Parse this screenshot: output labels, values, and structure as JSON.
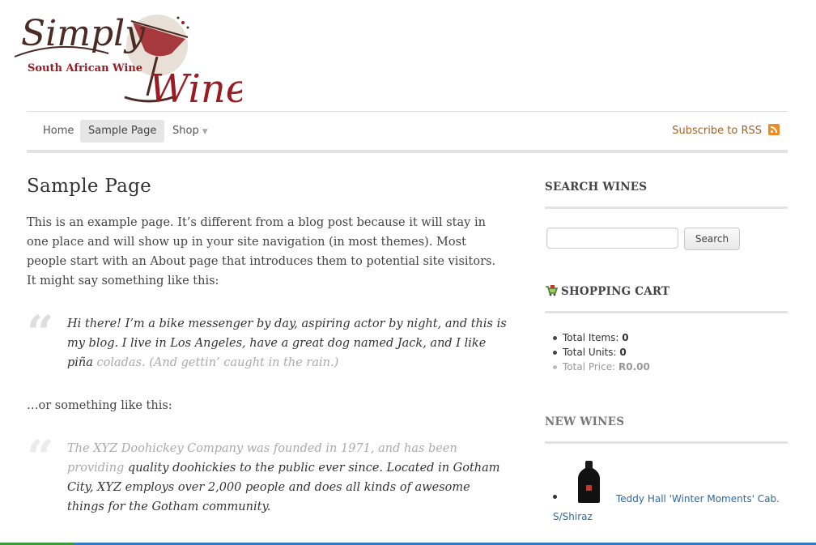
{
  "logo": {
    "word1": "Simply",
    "word2": "Wine",
    "tagline": "South African Wine",
    "colors": {
      "brown": "#4a2a22",
      "red": "#9a1b22"
    }
  },
  "nav": {
    "items": [
      {
        "label": "Home",
        "active": false
      },
      {
        "label": "Sample Page",
        "active": true
      },
      {
        "label": "Shop",
        "active": false,
        "has_dropdown": true
      }
    ],
    "caret": "▼",
    "rss_label": "Subscribe to RSS",
    "rss_icon": "rss-icon"
  },
  "main": {
    "title": "Sample Page",
    "intro": "This is an example page. It’s different from a blog post because it will stay in one place and will show up in your site navigation (in most themes). Most people start with an About page that introduces them to potential site visitors. It might say something like this:",
    "quote1": {
      "mark": "“",
      "text": "Hi there! I’m a bike messenger by day, aspiring actor by night, and this is my blog. I live in Los Angeles, have a great dog named Jack, and I like piña",
      "faded": "coladas. (And gettin’ caught in the rain.)"
    },
    "middle": "…or something like this:",
    "quote2": {
      "mark": "“",
      "faded": "The XYZ Doohickey Company was founded in 1971, and has been providing",
      "text": "quality doohickies to the public ever since. Located in Gotham City, XYZ employs over 2,000 people and does all kinds of awesome things for the Gotham community."
    }
  },
  "sidebar": {
    "search": {
      "heading": "SEARCH WINES",
      "input_value": "",
      "placeholder": "",
      "button_label": "Search"
    },
    "cart": {
      "heading": "SHOPPING CART",
      "icon": "shopping-cart-icon",
      "items": [
        {
          "label": "Total Items:",
          "value": "0"
        },
        {
          "label": "Total Units:",
          "value": "0"
        },
        {
          "label": "Total Price:",
          "value": "R0.00"
        }
      ]
    },
    "new_wines": {
      "heading": "NEW WINES",
      "items": [
        {
          "name_line1": "Teddy Hall 'Winter Moments' Cab.",
          "name_line2": "S/Shiraz",
          "image": "wine-bottle"
        }
      ]
    }
  }
}
